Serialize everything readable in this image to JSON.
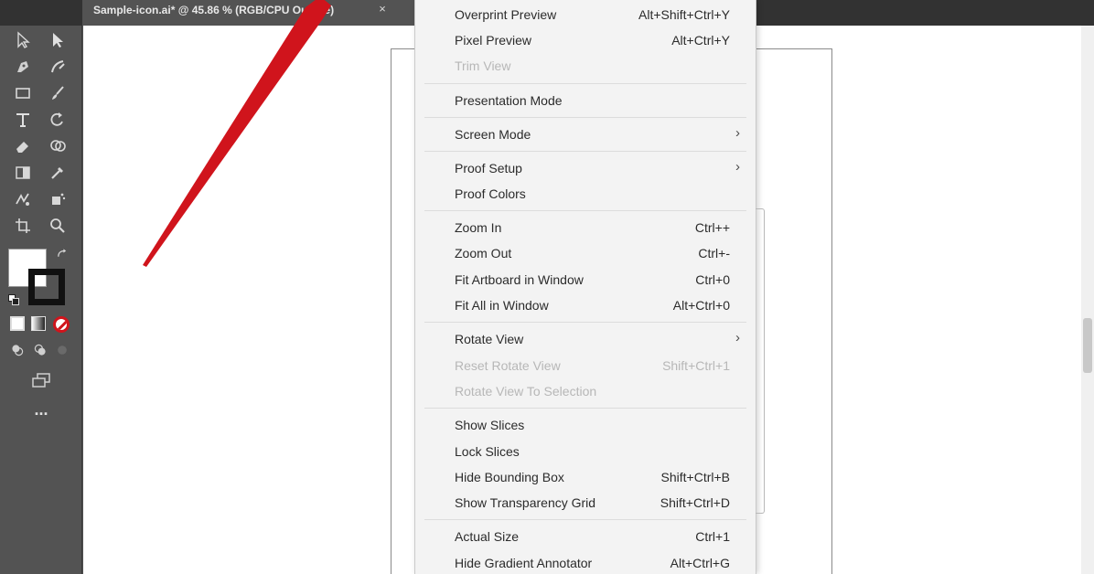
{
  "document": {
    "tab_title": "Sample-icon.ai* @ 45.86 % (RGB/CPU Outline)",
    "close_glyph": "×"
  },
  "toolbar": {
    "more_tools_label": "..."
  },
  "menu": {
    "items": [
      {
        "label": "Overprint Preview",
        "shortcut": "Alt+Shift+Ctrl+Y"
      },
      {
        "label": "Pixel Preview",
        "shortcut": "Alt+Ctrl+Y"
      },
      {
        "label": "Trim View",
        "shortcut": ""
      },
      {
        "label": "Presentation Mode",
        "shortcut": ""
      },
      {
        "label": "Screen Mode",
        "shortcut": ""
      },
      {
        "label": "Proof Setup",
        "shortcut": ""
      },
      {
        "label": "Proof Colors",
        "shortcut": ""
      },
      {
        "label": "Zoom In",
        "shortcut": "Ctrl++"
      },
      {
        "label": "Zoom Out",
        "shortcut": "Ctrl+-"
      },
      {
        "label": "Fit Artboard in Window",
        "shortcut": "Ctrl+0"
      },
      {
        "label": "Fit All in Window",
        "shortcut": "Alt+Ctrl+0"
      },
      {
        "label": "Rotate View",
        "shortcut": ""
      },
      {
        "label": "Reset Rotate View",
        "shortcut": "Shift+Ctrl+1"
      },
      {
        "label": "Rotate View To Selection",
        "shortcut": ""
      },
      {
        "label": "Show Slices",
        "shortcut": ""
      },
      {
        "label": "Lock Slices",
        "shortcut": ""
      },
      {
        "label": "Hide Bounding Box",
        "shortcut": "Shift+Ctrl+B"
      },
      {
        "label": "Show Transparency Grid",
        "shortcut": "Shift+Ctrl+D"
      },
      {
        "label": "Actual Size",
        "shortcut": "Ctrl+1"
      },
      {
        "label": "Hide Gradient Annotator",
        "shortcut": "Alt+Ctrl+G"
      }
    ],
    "submenu_arrow": "›"
  },
  "annotation": {
    "color": "#d0141c"
  },
  "colors": {
    "panel": "#535353",
    "tabbar": "#323232",
    "menu_bg": "#f3f3f3",
    "disabled_text": "#b7b7b7"
  }
}
